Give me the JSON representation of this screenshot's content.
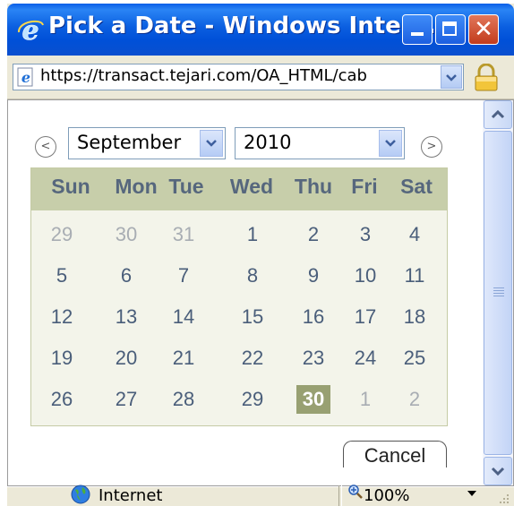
{
  "window": {
    "title": "Pick a Date - Windows Inter..."
  },
  "address_bar": {
    "url": "https://transact.tejari.com/OA_HTML/cab"
  },
  "calendar": {
    "month": "September",
    "year": "2010",
    "prev_icon": "chevron-left-circle-icon",
    "next_icon": "chevron-right-circle-icon",
    "weekdays": [
      "Sun",
      "Mon",
      "Tue",
      "Wed",
      "Thu",
      "Fri",
      "Sat"
    ],
    "weeks": [
      [
        {
          "d": "29",
          "m": "prev"
        },
        {
          "d": "30",
          "m": "prev"
        },
        {
          "d": "31",
          "m": "prev"
        },
        {
          "d": "1",
          "m": "cur"
        },
        {
          "d": "2",
          "m": "cur"
        },
        {
          "d": "3",
          "m": "cur"
        },
        {
          "d": "4",
          "m": "cur"
        }
      ],
      [
        {
          "d": "5",
          "m": "cur"
        },
        {
          "d": "6",
          "m": "cur"
        },
        {
          "d": "7",
          "m": "cur"
        },
        {
          "d": "8",
          "m": "cur"
        },
        {
          "d": "9",
          "m": "cur"
        },
        {
          "d": "10",
          "m": "cur"
        },
        {
          "d": "11",
          "m": "cur"
        }
      ],
      [
        {
          "d": "12",
          "m": "cur"
        },
        {
          "d": "13",
          "m": "cur"
        },
        {
          "d": "14",
          "m": "cur"
        },
        {
          "d": "15",
          "m": "cur"
        },
        {
          "d": "16",
          "m": "cur"
        },
        {
          "d": "17",
          "m": "cur"
        },
        {
          "d": "18",
          "m": "cur"
        }
      ],
      [
        {
          "d": "19",
          "m": "cur"
        },
        {
          "d": "20",
          "m": "cur"
        },
        {
          "d": "21",
          "m": "cur"
        },
        {
          "d": "22",
          "m": "cur"
        },
        {
          "d": "23",
          "m": "cur"
        },
        {
          "d": "24",
          "m": "cur"
        },
        {
          "d": "25",
          "m": "cur"
        }
      ],
      [
        {
          "d": "26",
          "m": "cur"
        },
        {
          "d": "27",
          "m": "cur"
        },
        {
          "d": "28",
          "m": "cur"
        },
        {
          "d": "29",
          "m": "cur"
        },
        {
          "d": "30",
          "m": "sel"
        },
        {
          "d": "1",
          "m": "next"
        },
        {
          "d": "2",
          "m": "next"
        }
      ]
    ],
    "selected_day": "30",
    "cancel_label": "Cancel"
  },
  "status_bar": {
    "zone": "Internet",
    "zoom": "100%"
  },
  "colors": {
    "title_bar": "#0054e3",
    "calendar_header": "#c7ceaa",
    "calendar_body": "#f3f4ea",
    "selected_day": "#98a072",
    "day_text": "#4a5e7a",
    "other_month_text": "#a8adb3"
  }
}
